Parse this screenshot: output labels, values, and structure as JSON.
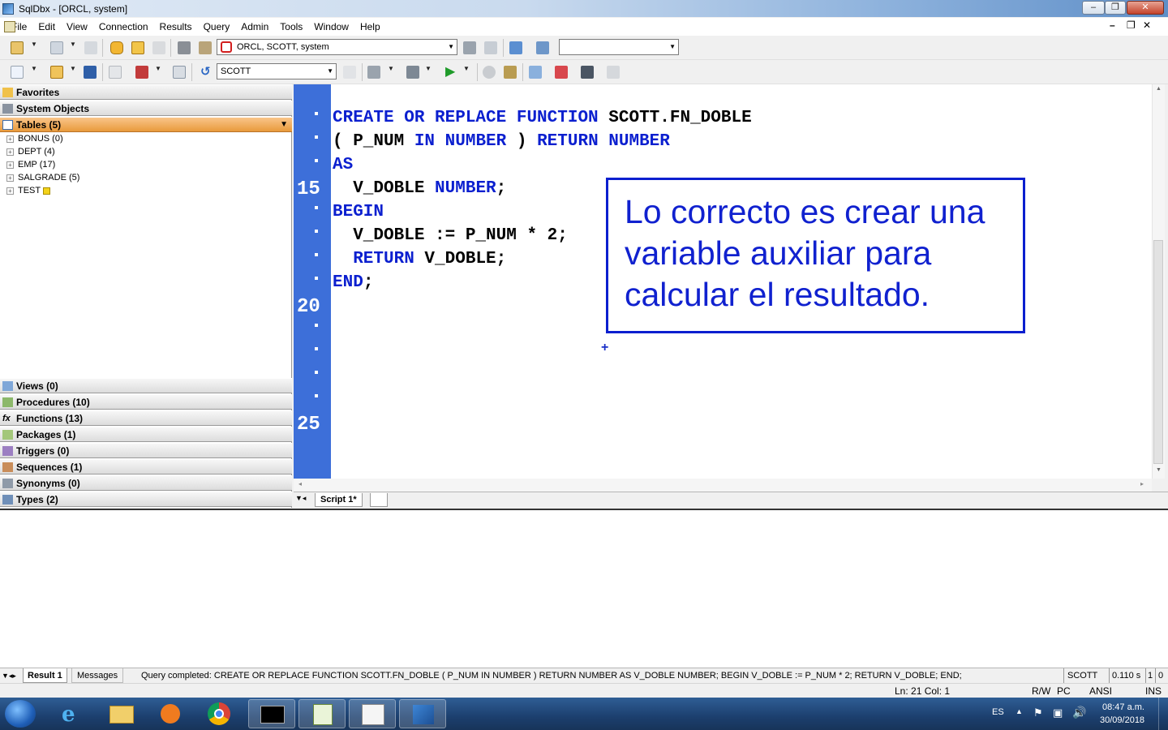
{
  "window": {
    "title": "SqlDbx - [ORCL, system]",
    "controls": {
      "min": "–",
      "max": "❐",
      "close": "✕"
    },
    "mdi_controls": {
      "min": "–",
      "restore": "❐",
      "close": "✕"
    }
  },
  "menu": [
    "File",
    "Edit",
    "View",
    "Connection",
    "Results",
    "Query",
    "Admin",
    "Tools",
    "Window",
    "Help"
  ],
  "toolbar1": {
    "connection": "ORCL, SCOTT, system",
    "extra_combo": ""
  },
  "toolbar2": {
    "schema": "SCOTT"
  },
  "objects": {
    "categories_top": [
      {
        "label": "Favorites"
      },
      {
        "label": "System Objects"
      },
      {
        "label": "Tables  (5)"
      }
    ],
    "tables": [
      {
        "name": "BONUS  (0)"
      },
      {
        "name": "DEPT  (4)"
      },
      {
        "name": "EMP  (17)"
      },
      {
        "name": "SALGRADE  (5)"
      },
      {
        "name": "TEST",
        "badge": "T"
      }
    ],
    "categories_bottom": [
      {
        "label": "Views  (0)"
      },
      {
        "label": "Procedures  (10)"
      },
      {
        "label": "Functions  (13)"
      },
      {
        "label": "Packages  (1)"
      },
      {
        "label": "Triggers  (0)"
      },
      {
        "label": "Sequences  (1)"
      },
      {
        "label": "Synonyms  (0)"
      },
      {
        "label": "Types  (2)"
      }
    ]
  },
  "editor": {
    "line_numbers": [
      "15",
      "20",
      "25"
    ],
    "code": [
      [
        {
          "t": "CREATE OR REPLACE FUNCTION ",
          "k": true
        },
        {
          "t": "SCOTT.FN_DOBLE",
          "k": false
        }
      ],
      [
        {
          "t": "( P_NUM ",
          "k": false
        },
        {
          "t": "IN NUMBER",
          "k": true
        },
        {
          "t": " ) ",
          "k": false
        },
        {
          "t": "RETURN NUMBER",
          "k": true
        }
      ],
      [
        {
          "t": "AS",
          "k": true
        }
      ],
      [
        {
          "t": "  V_DOBLE ",
          "k": false
        },
        {
          "t": "NUMBER",
          "k": true
        },
        {
          "t": ";",
          "k": false
        }
      ],
      [
        {
          "t": "BEGIN",
          "k": true
        }
      ],
      [
        {
          "t": "  V_DOBLE := P_NUM * 2;",
          "k": false
        }
      ],
      [
        {
          "t": "  RETURN",
          "k": true
        },
        {
          "t": " V_DOBLE;",
          "k": false
        }
      ],
      [
        {
          "t": "END",
          "k": true
        },
        {
          "t": ";",
          "k": false
        }
      ]
    ],
    "callout": "Lo correcto es crear una variable auxiliar para calcular el resultado.",
    "cursor": "+"
  },
  "tabs": {
    "script": "Script 1*"
  },
  "results_bar": {
    "result_tab": "Result 1",
    "messages_tab": "Messages",
    "message": "Query completed: CREATE OR REPLACE FUNCTION SCOTT.FN_DOBLE ( P_NUM IN NUMBER ) RETURN NUMBER AS   V_DOBLE NUMBER; BEGIN   V_DOBLE := P_NUM * 2;   RETURN V_DOBLE; END;",
    "user": "SCOTT",
    "time": "0.110 s",
    "rows": "1",
    "cols": "0"
  },
  "status": {
    "position": "Ln: 21  Col: 1",
    "rw": "R/W",
    "pc": "PC",
    "encoding": "ANSI",
    "mode": "INS"
  },
  "taskbar": {
    "lang": "ES",
    "time": "08:47 a.m.",
    "date": "30/09/2018"
  }
}
